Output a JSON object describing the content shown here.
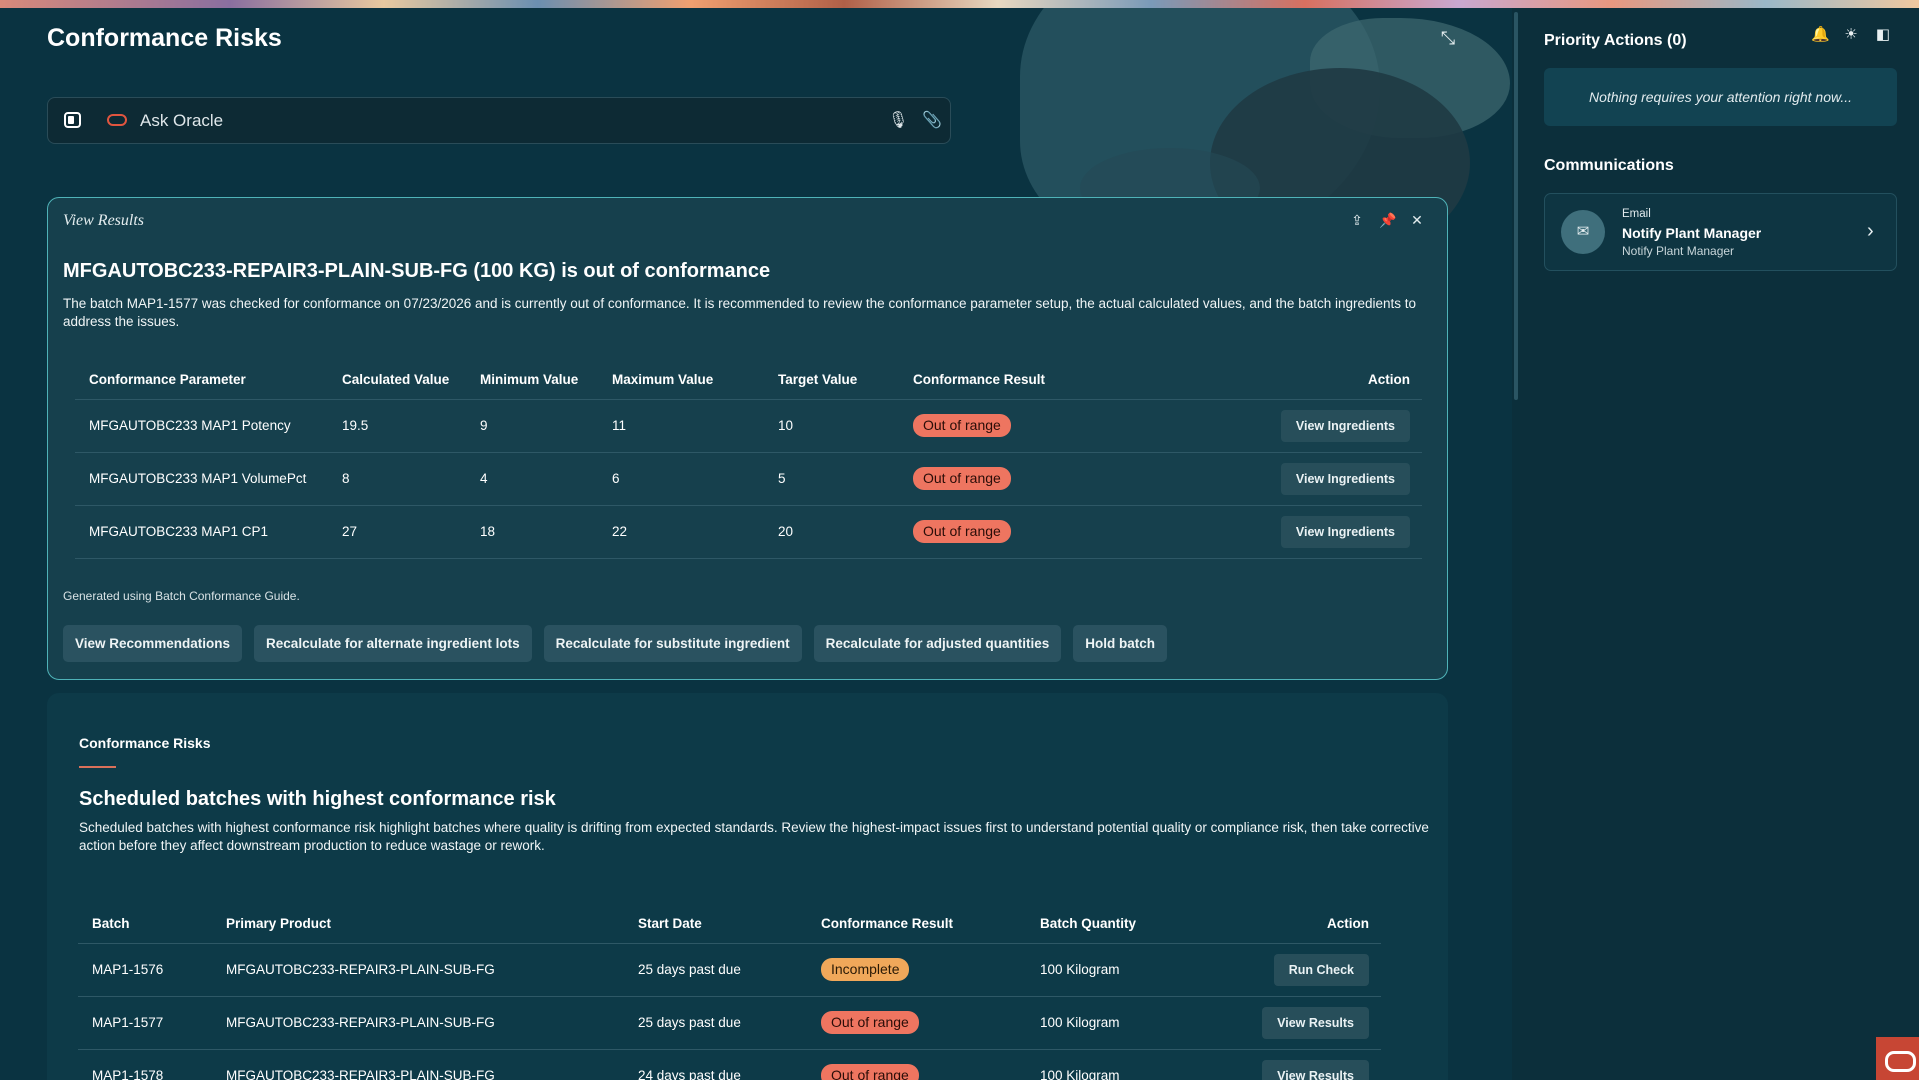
{
  "page": {
    "title": "Conformance Risks"
  },
  "ask_bar": {
    "placeholder": "Ask Oracle"
  },
  "view_results": {
    "panel_title": "View Results",
    "heading": "MFGAUTOBC233-REPAIR3-PLAIN-SUB-FG (100 KG) is out of conformance",
    "description": "The batch MAP1-1577 was checked for conformance on 07/23/2026 and is currently out of conformance. It is recommended to review the conformance parameter setup, the actual calculated values, and the batch ingredients to address the issues.",
    "columns": [
      "Conformance Parameter",
      "Calculated Value",
      "Minimum Value",
      "Maximum Value",
      "Target Value",
      "Conformance Result",
      "Action"
    ],
    "rows": [
      {
        "parameter": "MFGAUTOBC233 MAP1 Potency",
        "calculated": "19.5",
        "minimum": "9",
        "maximum": "11",
        "target": "10",
        "result": "Out of range",
        "action": "View Ingredients"
      },
      {
        "parameter": "MFGAUTOBC233 MAP1 VolumePct",
        "calculated": "8",
        "minimum": "4",
        "maximum": "6",
        "target": "5",
        "result": "Out of range",
        "action": "View Ingredients"
      },
      {
        "parameter": "MFGAUTOBC233 MAP1 CP1",
        "calculated": "27",
        "minimum": "18",
        "maximum": "22",
        "target": "20",
        "result": "Out of range",
        "action": "View Ingredients"
      }
    ],
    "generated_note": "Generated using Batch Conformance Guide.",
    "actions": [
      "View Recommendations",
      "Recalculate for alternate ingredient lots",
      "Recalculate for substitute ingredient",
      "Recalculate for adjusted quantities",
      "Hold batch"
    ]
  },
  "risks": {
    "section_label": "Conformance Risks",
    "heading": "Scheduled batches with highest conformance risk",
    "description": "Scheduled batches with highest conformance risk highlight batches where quality is drifting from expected standards. Review the highest-impact issues first to understand potential quality or compliance risk, then take corrective action before they affect downstream production to reduce wastage or rework.",
    "columns": [
      "Batch",
      "Primary Product",
      "Start Date",
      "Conformance Result",
      "Batch Quantity",
      "Action"
    ],
    "rows": [
      {
        "batch": "MAP1-1576",
        "product": "MFGAUTOBC233-REPAIR3-PLAIN-SUB-FG",
        "start": "25 days past due",
        "result": "Incomplete",
        "quantity": "100 Kilogram",
        "action": "Run Check"
      },
      {
        "batch": "MAP1-1577",
        "product": "MFGAUTOBC233-REPAIR3-PLAIN-SUB-FG",
        "start": "25 days past due",
        "result": "Out of range",
        "quantity": "100 Kilogram",
        "action": "View Results"
      },
      {
        "batch": "MAP1-1578",
        "product": "MFGAUTOBC233-REPAIR3-PLAIN-SUB-FG",
        "start": "24 days past due",
        "result": "Out of range",
        "quantity": "100 Kilogram",
        "action": "View Results"
      }
    ]
  },
  "sidebar": {
    "priority_title": "Priority Actions (0)",
    "empty_message": "Nothing requires your attention right now...",
    "communications_title": "Communications",
    "communication": {
      "kind": "Email",
      "name": "Notify Plant Manager",
      "subtitle": "Notify Plant Manager"
    }
  },
  "colors": {
    "background": "#0a3341",
    "accent_border": "#4fb3b8",
    "out_of_range": "#ee7560",
    "incomplete": "#f0a85a",
    "oracle_red": "#c74634"
  }
}
